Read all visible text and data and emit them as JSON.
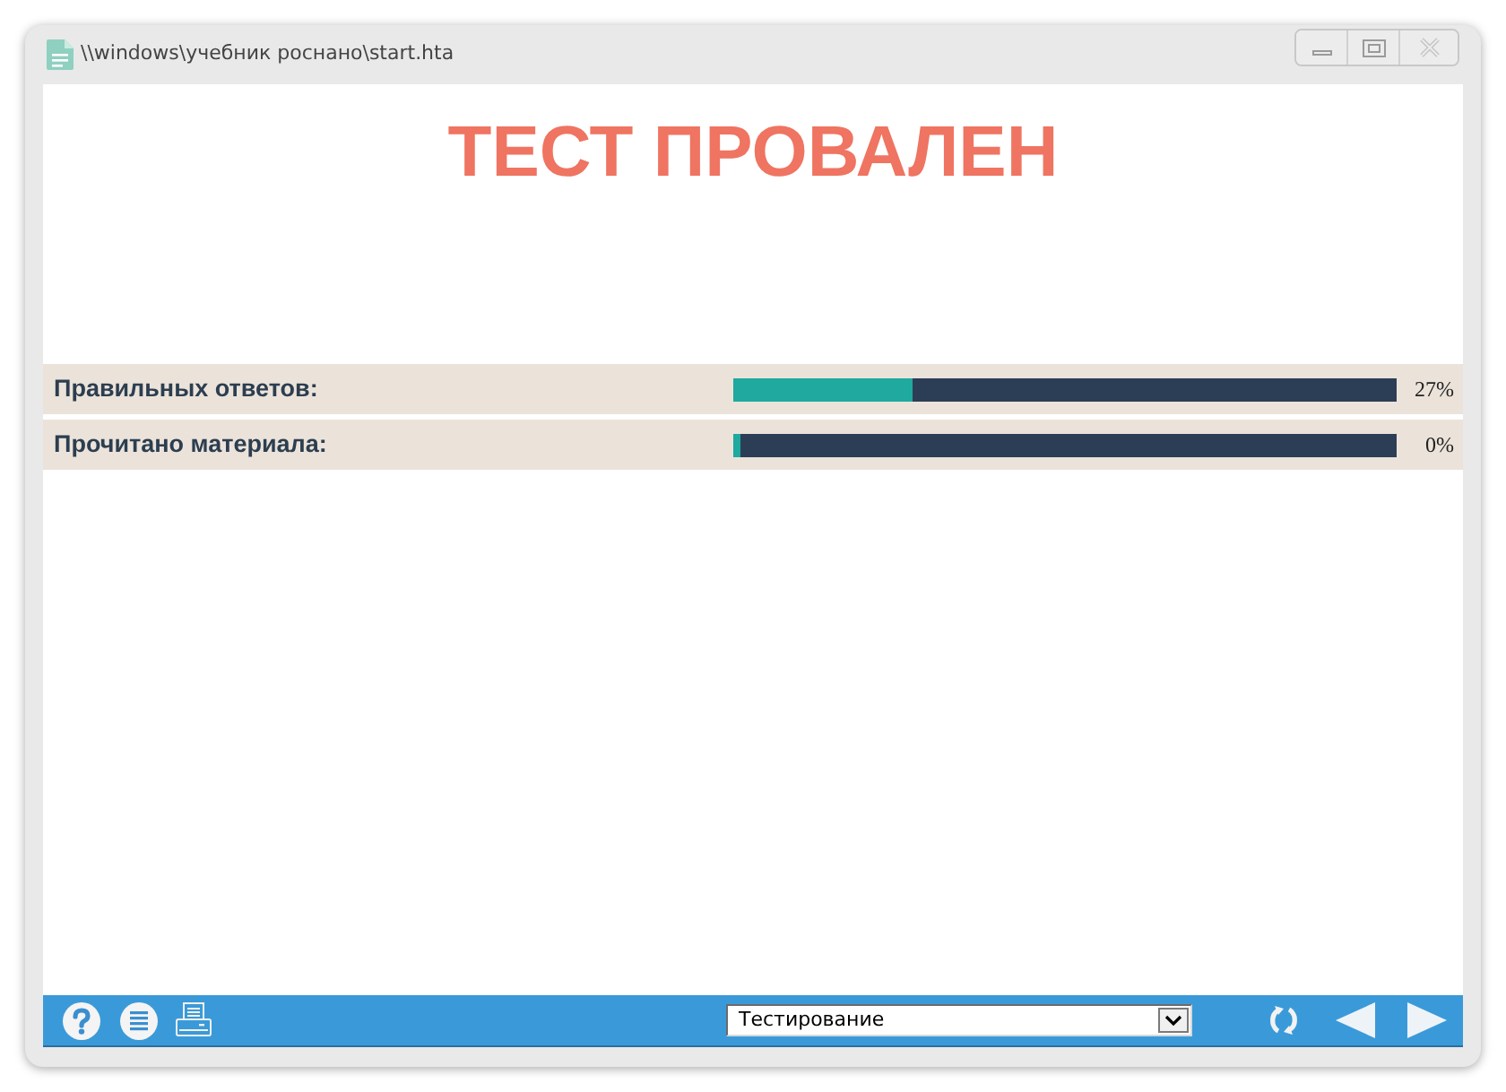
{
  "window": {
    "title": "\\\\windows\\учебник роснано\\start.hta"
  },
  "heading": "ТЕСТ ПРОВАЛЕН",
  "stats": [
    {
      "label": "Правильных ответов:",
      "level": 0.27,
      "reading": "27%"
    },
    {
      "label": "Прочитано материала:",
      "level": 0,
      "reading": "0%"
    }
  ],
  "toolbar": {
    "section_select": {
      "value": "Тестирование"
    }
  }
}
